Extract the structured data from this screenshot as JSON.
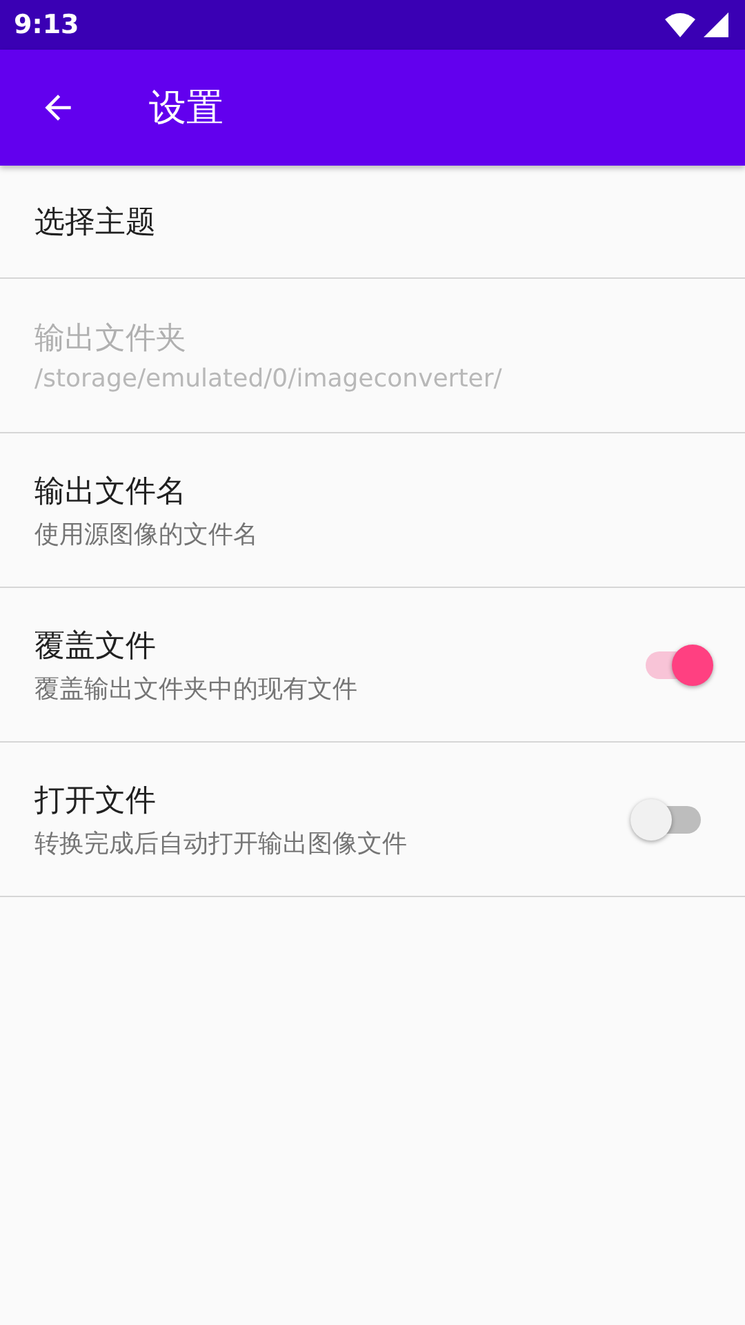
{
  "status_bar": {
    "time": "9:13"
  },
  "app_bar": {
    "title": "设置"
  },
  "preferences": [
    {
      "kind": "text",
      "title": "选择主题",
      "disabled": false
    },
    {
      "kind": "text",
      "title": "输出文件夹",
      "summary": "/storage/emulated/0/imageconverter/",
      "disabled": true
    },
    {
      "kind": "text",
      "title": "输出文件名",
      "summary": "使用源图像的文件名",
      "disabled": false
    },
    {
      "kind": "switch",
      "title": "覆盖文件",
      "summary": "覆盖输出文件夹中的现有文件",
      "disabled": false,
      "on": true
    },
    {
      "kind": "switch",
      "title": "打开文件",
      "summary": "转换完成后自动打开输出图像文件",
      "disabled": false,
      "on": false
    }
  ]
}
